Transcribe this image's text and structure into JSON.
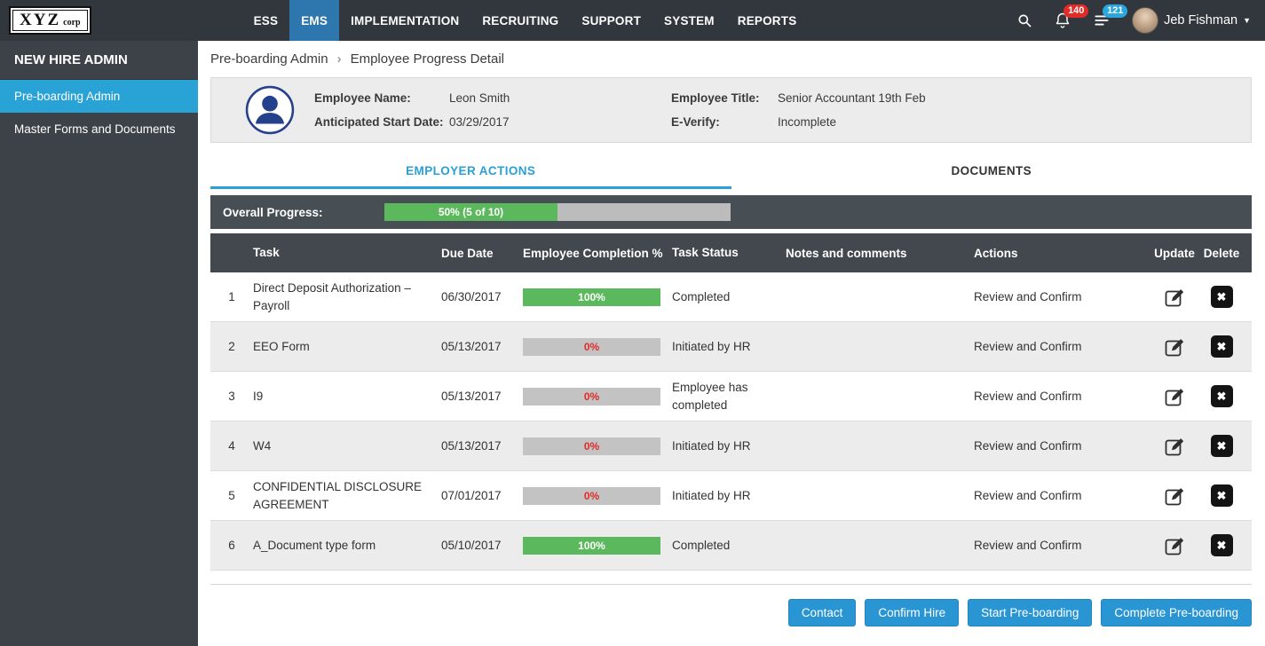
{
  "colors": {
    "topbar_bg": "#31373c",
    "nav_active_blue": "#2d77ae",
    "sidebar_bg": "#3c4247",
    "sidebar_active_blue": "#29a2d5",
    "accent_blue": "#2a9fd8",
    "button_blue": "#2a95d3",
    "progress_green": "#5cb85c",
    "zero_red": "#e02b27",
    "badge_red": "#e02b27",
    "badge_blue": "#2aa8dd",
    "table_header_bg": "#42484e"
  },
  "topbar": {
    "logo_main": "XYZ",
    "logo_sub": "corp",
    "nav": [
      {
        "label": "ESS"
      },
      {
        "label": "EMS",
        "active": true
      },
      {
        "label": "IMPLEMENTATION"
      },
      {
        "label": "RECRUITING"
      },
      {
        "label": "SUPPORT"
      },
      {
        "label": "SYSTEM"
      },
      {
        "label": "REPORTS"
      }
    ],
    "notifications_count": "140",
    "queue_count": "121",
    "user_name": "Jeb Fishman",
    "caret": "▼"
  },
  "sidebar": {
    "title": "NEW HIRE ADMIN",
    "items": [
      {
        "label": "Pre-boarding Admin",
        "active": true
      },
      {
        "label": "Master Forms and Documents"
      }
    ]
  },
  "breadcrumb": {
    "parent": "Pre-boarding Admin",
    "separator": "›",
    "current": "Employee Progress Detail"
  },
  "employee": {
    "name_label": "Employee Name:",
    "name": "Leon Smith",
    "title_label": "Employee Title:",
    "title": "Senior Accountant 19th Feb",
    "start_label": "Anticipated Start Date:",
    "start": "03/29/2017",
    "everify_label": "E-Verify:",
    "everify": "Incomplete"
  },
  "tabs": [
    {
      "label": "EMPLOYER ACTIONS",
      "active": true
    },
    {
      "label": "DOCUMENTS"
    }
  ],
  "progress": {
    "label": "Overall Progress:",
    "percent": 50,
    "text": "50% (5 of 10)"
  },
  "table": {
    "headers": {
      "task": "Task",
      "due": "Due Date",
      "completion": "Employee Completion %",
      "status": "Task Status",
      "notes": "Notes and comments",
      "actions": "Actions",
      "update": "Update",
      "delete": "Delete"
    },
    "rows": [
      {
        "num": "1",
        "task": "Direct Deposit Authorization – Payroll",
        "due": "06/30/2017",
        "completion": 100,
        "completion_text": "100%",
        "status": "Completed",
        "notes": "",
        "action": "Review and Confirm"
      },
      {
        "num": "2",
        "task": "EEO Form",
        "due": "05/13/2017",
        "completion": 0,
        "completion_text": "0%",
        "status": "Initiated by HR",
        "notes": "",
        "action": "Review and Confirm"
      },
      {
        "num": "3",
        "task": "I9",
        "due": "05/13/2017",
        "completion": 0,
        "completion_text": "0%",
        "status": "Employee has completed",
        "notes": "",
        "action": "Review and Confirm"
      },
      {
        "num": "4",
        "task": "W4",
        "due": "05/13/2017",
        "completion": 0,
        "completion_text": "0%",
        "status": "Initiated by HR",
        "notes": "",
        "action": "Review and Confirm"
      },
      {
        "num": "5",
        "task": "CONFIDENTIAL DISCLOSURE AGREEMENT",
        "due": "07/01/2017",
        "completion": 0,
        "completion_text": "0%",
        "status": "Initiated by HR",
        "notes": "",
        "action": "Review and Confirm"
      },
      {
        "num": "6",
        "task": "A_Document type form",
        "due": "05/10/2017",
        "completion": 100,
        "completion_text": "100%",
        "status": "Completed",
        "notes": "",
        "action": "Review and Confirm"
      }
    ]
  },
  "icons": {
    "delete_glyph": "✖"
  },
  "footer": {
    "buttons": [
      "Contact",
      "Confirm Hire",
      "Start Pre-boarding",
      "Complete Pre-boarding"
    ]
  }
}
